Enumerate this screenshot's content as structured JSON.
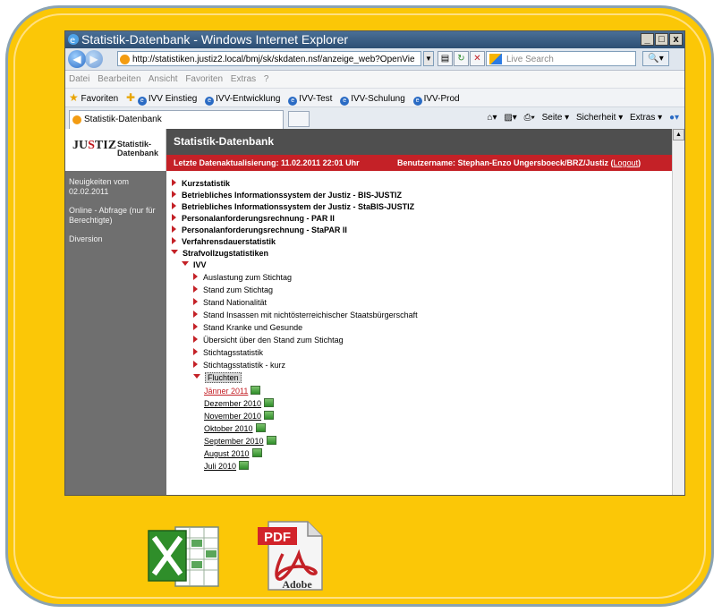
{
  "window": {
    "title": "Statistik-Datenbank - Windows Internet Explorer",
    "controls": [
      "_",
      "□",
      "x"
    ]
  },
  "address_bar": {
    "url": "http://statistiken.justiz2.local/bmj/sk/skdaten.nsf/anzeige_web?OpenVie",
    "search_placeholder": "Live Search"
  },
  "menu": [
    "Datei",
    "Bearbeiten",
    "Ansicht",
    "Favoriten",
    "Extras",
    "?"
  ],
  "favorites": {
    "label": "Favoriten",
    "items": [
      "IVV Einstieg",
      "IVV-Entwicklung",
      "IVV-Test",
      "IVV-Schulung",
      "IVV-Prod"
    ]
  },
  "tab": {
    "label": "Statistik-Datenbank"
  },
  "command_bar": [
    "Seite ▾",
    "Sicherheit ▾",
    "Extras ▾"
  ],
  "page": {
    "logo": {
      "text": "JUSTIZ",
      "highlight": "S",
      "subtitle_line1": "Statistik-",
      "subtitle_line2": "Datenbank"
    },
    "header_title": "Statistik-Datenbank",
    "update_text": "Letzte Datenaktualisierung: 11.02.2011 22:01 Uhr",
    "user_text": "Benutzername: Stephan-Enzo Ungersboeck/BRZ/Justiz",
    "logout": "Logout",
    "sidebar": [
      "Neuigkeiten vom 02.02.2011",
      "Online - Abfrage (nur für Berechtigte)",
      "Diversion"
    ],
    "tree": {
      "top": [
        "Kurzstatistik",
        "Betriebliches Informationssystem der Justiz - BIS-JUSTIZ",
        "Betriebliches Informationssystem der Justiz - StaBIS-JUSTIZ",
        "Personalanforderungsrechnung - PAR II",
        "Personalanforderungsrechnung - StaPAR II",
        "Verfahrensdauerstatistik"
      ],
      "expanded": "Strafvollzugstatistiken",
      "sub": "IVV",
      "ivv_items": [
        "Auslastung zum Stichtag",
        "Stand zum Stichtag",
        "Stand Nationalität",
        "Stand Insassen mit nichtösterreichischer Staatsbürgerschaft",
        "Stand Kranke und Gesunde",
        "Übersicht über den Stand zum Stichtag",
        "Stichtagsstatistik",
        "Stichtagsstatistik - kurz"
      ],
      "selected": "Fluchten",
      "months": [
        "Jänner 2011",
        "Dezember 2010",
        "November 2010",
        "Oktober 2010",
        "September 2010",
        "August 2010",
        "Juli 2010"
      ]
    }
  },
  "icons": {
    "excel": "excel-file-icon",
    "pdf": {
      "label": "PDF",
      "brand": "Adobe"
    }
  },
  "colors": {
    "card_bg": "#fbc707",
    "header_red": "#c42127",
    "header_dark": "#4f4f4f",
    "sidebar": "#6f6f6f"
  }
}
